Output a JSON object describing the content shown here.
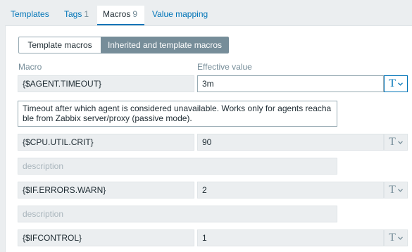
{
  "tabs": [
    {
      "label": "Templates",
      "count": ""
    },
    {
      "label": "Tags",
      "count": "1"
    },
    {
      "label": "Macros",
      "count": "9"
    },
    {
      "label": "Value mapping",
      "count": ""
    }
  ],
  "toggle": {
    "template_macros": "Template macros",
    "inherited": "Inherited and template macros"
  },
  "headers": {
    "macro": "Macro",
    "effective_value": "Effective value"
  },
  "type_glyph": "T",
  "macros": [
    {
      "name": "{$AGENT.TIMEOUT}",
      "value": "3m",
      "description": "Timeout after which agent is considered unavailable. Works only for agents reacha ble from Zabbix server/proxy (passive mode).",
      "description_placeholder": ""
    },
    {
      "name": "{$CPU.UTIL.CRIT}",
      "value": "90",
      "description": "",
      "description_placeholder": "description"
    },
    {
      "name": "{$IF.ERRORS.WARN}",
      "value": "2",
      "description": "",
      "description_placeholder": "description"
    },
    {
      "name": "{$IFCONTROL}",
      "value": "1",
      "description": "",
      "description_placeholder": ""
    }
  ],
  "colors": {
    "link": "#0275b8",
    "active_segment": "#768d99",
    "background": "#ebeef0"
  }
}
